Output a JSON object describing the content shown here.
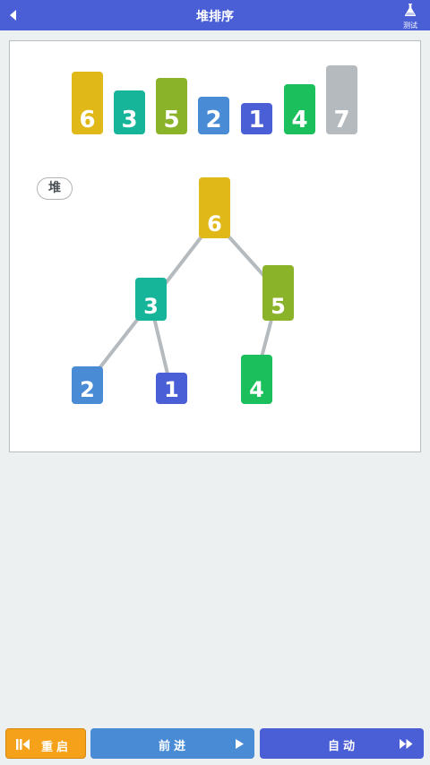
{
  "header": {
    "title": "堆排序",
    "test_label": "测试"
  },
  "array": {
    "items": [
      {
        "value": "6",
        "color": "#e0b918"
      },
      {
        "value": "3",
        "color": "#16b59a"
      },
      {
        "value": "5",
        "color": "#8bb32a"
      },
      {
        "value": "2",
        "color": "#4a8bd6"
      },
      {
        "value": "1",
        "color": "#4a5fd6"
      },
      {
        "value": "4",
        "color": "#1bbf5c"
      },
      {
        "value": "7",
        "color": "#b5babe"
      }
    ]
  },
  "heap": {
    "label": "堆",
    "nodes": [
      {
        "value": "6",
        "color": "#e0b918"
      },
      {
        "value": "3",
        "color": "#16b59a"
      },
      {
        "value": "5",
        "color": "#8bb32a"
      },
      {
        "value": "2",
        "color": "#4a8bd6"
      },
      {
        "value": "1",
        "color": "#4a5fd6"
      },
      {
        "value": "4",
        "color": "#1bbf5c"
      }
    ],
    "edge_color": "#b5babe"
  },
  "buttons": {
    "reset": "重启",
    "next": "前进",
    "auto": "自动"
  }
}
